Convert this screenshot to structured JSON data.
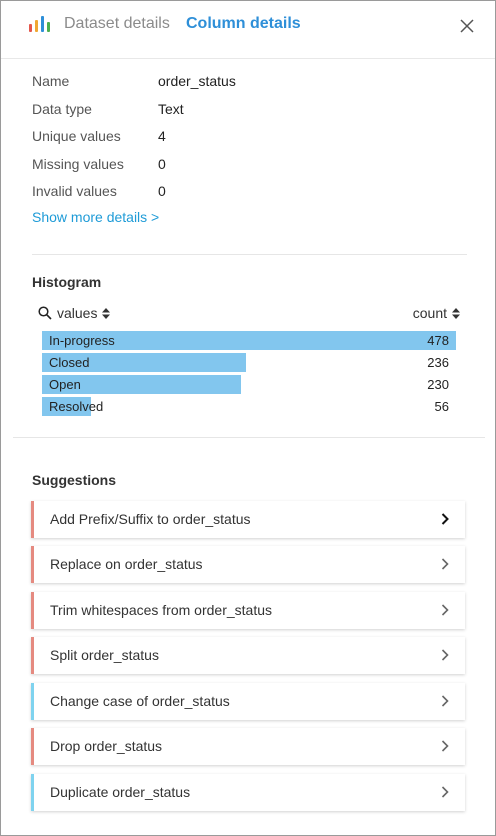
{
  "header": {
    "tabs": [
      {
        "label": "Dataset details",
        "active": false
      },
      {
        "label": "Column details",
        "active": true
      }
    ],
    "logo_colors": [
      "#e4574c",
      "#f0a732",
      "#2e8fd8",
      "#4caf50"
    ]
  },
  "details": {
    "rows": [
      {
        "label": "Name",
        "value": "order_status"
      },
      {
        "label": "Data type",
        "value": "Text"
      },
      {
        "label": "Unique values",
        "value": "4"
      },
      {
        "label": "Missing values",
        "value": "0"
      },
      {
        "label": "Invalid values",
        "value": "0"
      }
    ],
    "more_link": "Show more details >"
  },
  "histogram": {
    "title": "Histogram",
    "col_values": "values",
    "col_count": "count",
    "rows": [
      {
        "label": "In-progress",
        "count": "478",
        "n": 478
      },
      {
        "label": "Closed",
        "count": "236",
        "n": 236
      },
      {
        "label": "Open",
        "count": "230",
        "n": 230
      },
      {
        "label": "Resolved",
        "count": "56",
        "n": 56
      }
    ],
    "bar_color": "#82c6ee"
  },
  "suggestions": {
    "title": "Suggestions",
    "items": [
      {
        "label": "Add Prefix/Suffix to order_status",
        "accent": "#e58a80"
      },
      {
        "label": "Replace on order_status",
        "accent": "#e58a80"
      },
      {
        "label": "Trim whitespaces from order_status",
        "accent": "#e58a80"
      },
      {
        "label": "Split order_status",
        "accent": "#e58a80"
      },
      {
        "label": "Change case of order_status",
        "accent": "#7fd3ef"
      },
      {
        "label": "Drop order_status",
        "accent": "#e58a80"
      },
      {
        "label": "Duplicate order_status",
        "accent": "#7fd3ef"
      }
    ]
  }
}
